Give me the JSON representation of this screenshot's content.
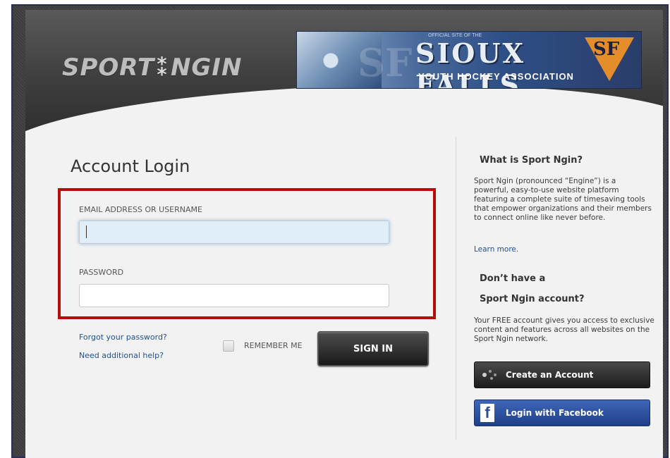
{
  "header": {
    "logo_text_left": "SPORT",
    "logo_text_right": "NGIN",
    "banner": {
      "small_text": "OFFICIAL SITE OF THE",
      "title": "SIOUX FALLS",
      "subtitle": "YOUTH HOCKEY ASSOCIATION",
      "badge": "SF",
      "accent_color": "#e58d2b"
    }
  },
  "login": {
    "title": "Account Login",
    "email_label": "EMAIL ADDRESS OR USERNAME",
    "email_value": "",
    "password_label": "PASSWORD",
    "password_value": "",
    "forgot_link": "Forgot your password?",
    "help_link": "Need additional help?",
    "remember_label": "REMEMBER ME",
    "remember_checked": false,
    "sign_in_label": "SIGN IN",
    "highlight_color": "#b40d0d"
  },
  "sidebar": {
    "what_heading": "What is Sport Ngin?",
    "what_text": "Sport Ngin (pronounced “Engine”) is a powerful, easy-to-use website platform featuring a complete suite of timesaving tools that empower organizations and their members to connect online like never before.",
    "learn_more": "Learn more.",
    "dont_heading_line1": "Don’t have a",
    "dont_heading_line2": "Sport Ngin account?",
    "free_text": "Your FREE account gives you access to exclusive content and features across all websites on the Sport Ngin network.",
    "create_account_label": "Create an Account",
    "facebook_label": "Login with Facebook",
    "facebook_color": "#2b4f9a"
  }
}
